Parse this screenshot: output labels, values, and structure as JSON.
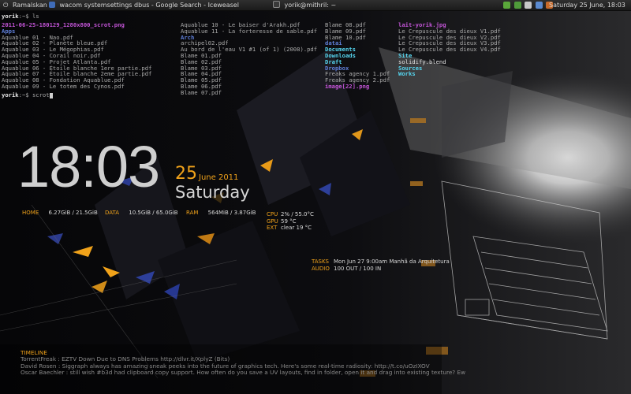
{
  "panel": {
    "left_label": "Ramalskan",
    "window_title": "wacom systemsettings dbus - Google Search - Iceweasel",
    "terminal_title": "yorik@mithril: ~",
    "clock": "Saturday 25 June, 18:03"
  },
  "terminal": {
    "prompt1_user": "yorik",
    "prompt1_rest": ":~$ ls",
    "col1": [
      "2011-06-25-180129_1280x800_scrot.png",
      "Apps",
      "Aquablue 01 - Nao.pdf",
      "Aquablue 02 - Planète bleue.pdf",
      "Aquablue 03 - Le Mégophias.pdf",
      "Aquablue 04 - Corail noir.pdf",
      "Aquablue 05 - Projet Atlanta.pdf",
      "Aquablue 06 - Étoile blanche 1ere partie.pdf",
      "Aquablue 07 - Étoile blanche 2eme partie.pdf",
      "Aquablue 08 - Fondation Aquablue.pdf",
      "Aquablue 09 - Le totem des Cynos.pdf"
    ],
    "col2": [
      "Aquablue 10 - Le baiser d'Arakh.pdf",
      "Aquablue 11 - La forteresse de sable.pdf",
      "Arch",
      "archipel02.pdf",
      "Au bord de l'eau V1 #1 (of 1) (2008).pdf",
      "Blame 01.pdf",
      "Blame 02.pdf",
      "Blame 03.pdf",
      "Blame 04.pdf",
      "Blame 05.pdf",
      "Blame 06.pdf",
      "Blame 07.pdf"
    ],
    "col3": [
      "Blame 08.pdf",
      "Blame 09.pdf",
      "Blame 10.pdf",
      "datai",
      "Documents",
      "Downloads",
      "Draft",
      "Dropbox",
      "Freaks agency 1.pdf",
      "Freaks agency 2.pdf",
      "image[22].png"
    ],
    "col4": [
      "lait-yorik.jpg",
      "Le Crepuscule des dieux V1.pdf",
      "Le Crepuscule des dieux V2.pdf",
      "Le Crepuscule des dieux V3.pdf",
      "Le Crepuscule des dieux V4.pdf",
      "Site",
      "solidify.blend",
      "Sources",
      "Works"
    ],
    "prompt2_user": "yorik",
    "prompt2_rest": ":~$ scrot"
  },
  "conky": {
    "time": "18:03",
    "day": "25",
    "month_year": "June 2011",
    "weekday": "Saturday",
    "home_label": "HOME",
    "home_value": "6.27GiB / 21.5GiB",
    "data_label": "DATA",
    "data_value": "10.5GiB / 65.0GiB",
    "ram_label": "RAM",
    "ram_value": "564MiB / 3.87GiB",
    "cpu_label": "CPU",
    "cpu_value": "2% / 55.0°C",
    "gpu_label": "GPU",
    "gpu_value": "59 °C",
    "ext_label": "EXT",
    "ext_value": "clear 19 °C",
    "tasks_label": "TASKS",
    "tasks_value": "Mon Jun 27   9:00am  Manhã da Arquitetura",
    "audio_label": "AUDIO",
    "audio_value": "100 OUT / 100 IN",
    "timeline_title": "TIMELINE",
    "timeline": [
      "TorrentFreak : EZTV Down Due to DNS Problems http://dlvr.it/XplyZ (Bits)",
      "David Rosen : Siggraph always has amazing sneak peeks into the future of graphics tech. Here's some real-time radiosity: http://t.co/uOzIXOV",
      "Oscar Baechler : still wish #b3d had clipboard copy support. How often do you save a UV layouts, find in folder, open it and drag into existing texture? Ew"
    ]
  }
}
